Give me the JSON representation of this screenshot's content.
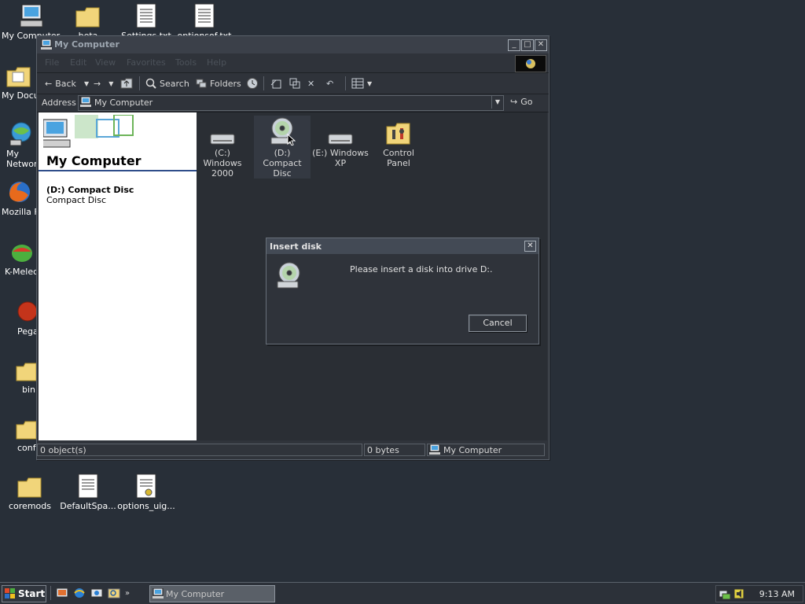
{
  "desktop": {
    "icons": [
      {
        "label": "My Computer"
      },
      {
        "label": "beta"
      },
      {
        "label": "Settings.txt"
      },
      {
        "label": "optionsof.txt"
      },
      {
        "label": "My Documents"
      },
      {
        "label": "My Network Places"
      },
      {
        "label": "Mozilla Firefox"
      },
      {
        "label": "K-Meleon"
      },
      {
        "label": "Pegasus"
      },
      {
        "label": "bin"
      },
      {
        "label": "conf"
      },
      {
        "label": "coremods"
      },
      {
        "label": "DefaultSpa..."
      },
      {
        "label": "options_uig..."
      }
    ]
  },
  "window": {
    "title": "My Computer",
    "menu": [
      "File",
      "Edit",
      "View",
      "Favorites",
      "Tools",
      "Help"
    ],
    "toolbar": {
      "back": "Back",
      "search": "Search",
      "folders": "Folders"
    },
    "address": {
      "label": "Address",
      "value": "My Computer",
      "go": "Go"
    },
    "left_pane": {
      "heading": "My Computer",
      "selected_title": "(D:) Compact Disc",
      "selected_type": "Compact Disc"
    },
    "items": [
      {
        "label": "(C:) Windows 2000"
      },
      {
        "label": "(D:) Compact Disc"
      },
      {
        "label": "(E:) Windows XP"
      },
      {
        "label": "Control Panel"
      }
    ],
    "status": {
      "objects": "0 object(s)",
      "size": "0 bytes",
      "zone": "My Computer"
    }
  },
  "dialog": {
    "title": "Insert disk",
    "message": "Please insert a disk into drive D:.",
    "cancel": "Cancel"
  },
  "taskbar": {
    "start": "Start",
    "task": "My Computer",
    "clock": "9:13 AM"
  }
}
